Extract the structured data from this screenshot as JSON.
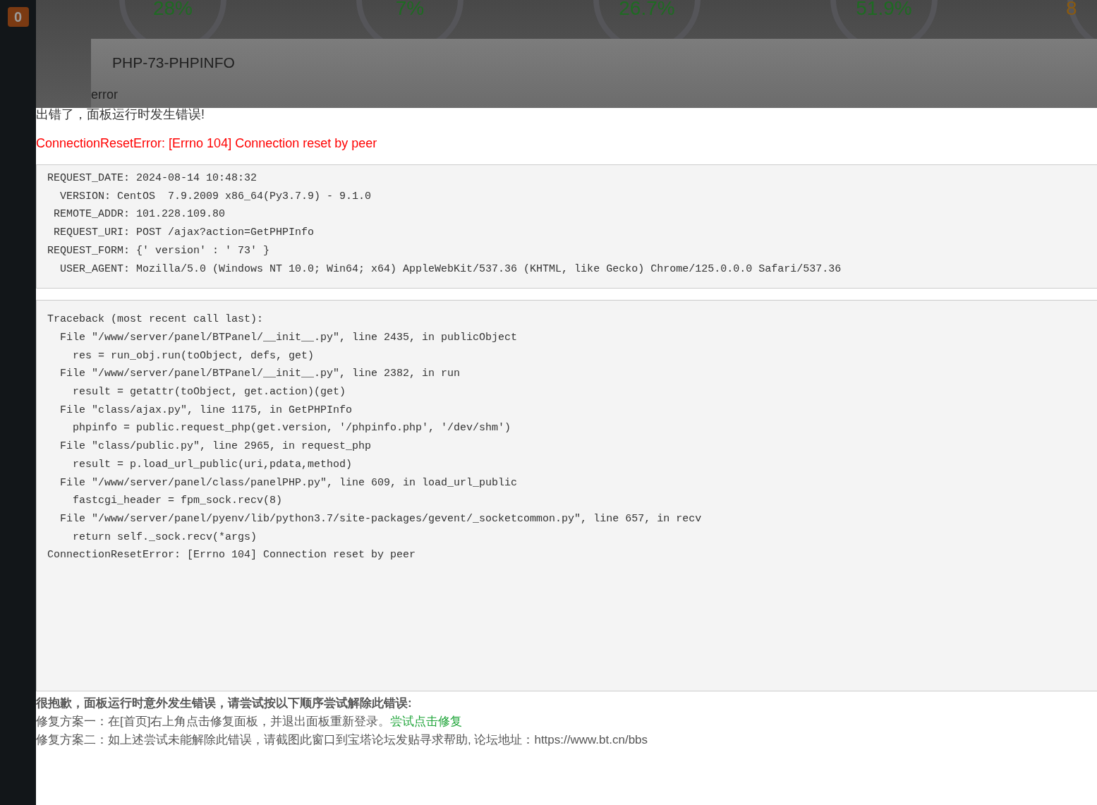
{
  "sidebar": {
    "badge": "0"
  },
  "gauges": [
    {
      "value": "28%",
      "color": "#1e6b22"
    },
    {
      "value": "7%",
      "color": "#1e6b22"
    },
    {
      "value": "26.7%",
      "color": "#1e6b22"
    },
    {
      "value": "51.9%",
      "color": "#1e6b22"
    },
    {
      "value": "8",
      "color": "#8a5a10"
    }
  ],
  "dialog": {
    "title": "PHP-73-PHPINFO",
    "subtitle": "error"
  },
  "error_page": {
    "heading": "出错了，面板运行时发生错误!",
    "error": "ConnectionResetError: [Errno 104] Connection reset by peer",
    "request_info": [
      "REQUEST_DATE: 2024-08-14 10:48:32",
      "  VERSION: CentOS  7.9.2009 x86_64(Py3.7.9) - 9.1.0",
      " REMOTE_ADDR: 101.228.109.80",
      " REQUEST_URI: POST /ajax?action=GetPHPInfo",
      "REQUEST_FORM: {′ version′ : ′ 73′ }",
      "  USER_AGENT: Mozilla/5.0 (Windows NT 10.0; Win64; x64) AppleWebKit/537.36 (KHTML, like Gecko) Chrome/125.0.0.0 Safari/537.36"
    ],
    "traceback": [
      "Traceback (most recent call last):",
      "  File \"/www/server/panel/BTPanel/__init__.py\", line 2435, in publicObject",
      "    res = run_obj.run(toObject, defs, get)",
      "  File \"/www/server/panel/BTPanel/__init__.py\", line 2382, in run",
      "    result = getattr(toObject, get.action)(get)",
      "  File \"class/ajax.py\", line 1175, in GetPHPInfo",
      "    phpinfo = public.request_php(get.version, '/phpinfo.php', '/dev/shm')",
      "  File \"class/public.py\", line 2965, in request_php",
      "    result = p.load_url_public(uri,pdata,method)",
      "  File \"/www/server/panel/class/panelPHP.py\", line 609, in load_url_public",
      "    fastcgi_header = fpm_sock.recv(8)",
      "  File \"/www/server/panel/pyenv/lib/python3.7/site-packages/gevent/_socketcommon.py\", line 657, in recv",
      "    return self._sock.recv(*args)",
      "ConnectionResetError: [Errno 104] Connection reset by peer"
    ],
    "help_title": "很抱歉，面板运行时意外发生错误，请尝试按以下顺序尝试解除此错误:",
    "fix_1": {
      "text": "修复方案一：在[首页]右上角点击修复面板，并退出面板重新登录。",
      "link": "尝试点击修复"
    },
    "fix_2": "修复方案二：如上述尝试未能解除此错误，请截图此窗口到宝塔论坛发贴寻求帮助, 论坛地址：https://www.bt.cn/bbs"
  }
}
